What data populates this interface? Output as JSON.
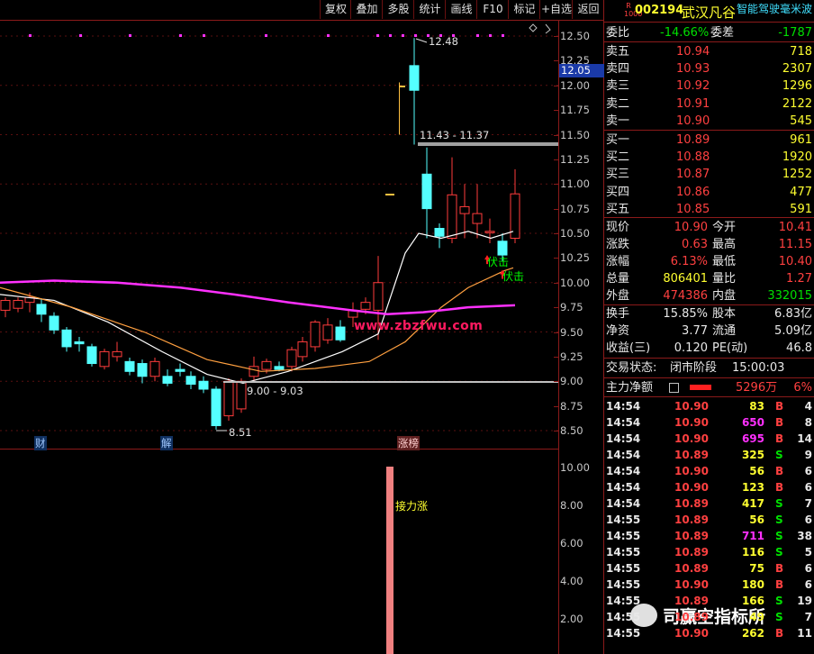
{
  "toolbar": {
    "buttons": [
      "复权",
      "叠加",
      "多股",
      "统计",
      "画线",
      "F10",
      "标记",
      "+自选",
      "返回"
    ]
  },
  "stock": {
    "market_tag": "R\n1000",
    "code": "002194",
    "name": "武汉凡谷",
    "concept": "智能驾驶毫米波"
  },
  "weibi": {
    "label1": "委比",
    "val1": "-14.66%",
    "label2": "委差",
    "val2": "-1787"
  },
  "sell_levels": [
    {
      "label": "卖五",
      "price": "10.94",
      "vol": "718"
    },
    {
      "label": "卖四",
      "price": "10.93",
      "vol": "2307"
    },
    {
      "label": "卖三",
      "price": "10.92",
      "vol": "1296"
    },
    {
      "label": "卖二",
      "price": "10.91",
      "vol": "2122"
    },
    {
      "label": "卖一",
      "price": "10.90",
      "vol": "545"
    }
  ],
  "buy_levels": [
    {
      "label": "买一",
      "price": "10.89",
      "vol": "961"
    },
    {
      "label": "买二",
      "price": "10.88",
      "vol": "1920"
    },
    {
      "label": "买三",
      "price": "10.87",
      "vol": "1252"
    },
    {
      "label": "买四",
      "price": "10.86",
      "vol": "477"
    },
    {
      "label": "买五",
      "price": "10.85",
      "vol": "591"
    }
  ],
  "quote": [
    {
      "l1": "现价",
      "v1": "10.90",
      "c1": "red",
      "l2": "今开",
      "v2": "10.41",
      "c2": "red"
    },
    {
      "l1": "涨跌",
      "v1": "0.63",
      "c1": "red",
      "l2": "最高",
      "v2": "11.15",
      "c2": "red"
    },
    {
      "l1": "涨幅",
      "v1": "6.13%",
      "c1": "red",
      "l2": "最低",
      "v2": "10.40",
      "c2": "red"
    },
    {
      "l1": "总量",
      "v1": "806401",
      "c1": "yel",
      "l2": "量比",
      "v2": "1.27",
      "c2": "red"
    },
    {
      "l1": "外盘",
      "v1": "474386",
      "c1": "red",
      "l2": "内盘",
      "v2": "332015",
      "c2": "grn"
    }
  ],
  "fundamentals": [
    {
      "l1": "换手",
      "v1": "15.85%",
      "l2": "股本",
      "v2": "6.83亿"
    },
    {
      "l1": "净资",
      "v1": "3.77",
      "l2": "流通",
      "v2": "5.09亿"
    },
    {
      "l1": "收益(三)",
      "v1": "0.120",
      "l2": "PE(动)",
      "v2": "46.8"
    }
  ],
  "trade_status": {
    "label": "交易状态:",
    "value": "闭市阶段",
    "time": "15:00:03"
  },
  "main_net": {
    "label": "主力净额",
    "value": "5296万",
    "pct": "6%"
  },
  "ticks": [
    {
      "t": "14:54",
      "p": "10.90",
      "v": "83",
      "vc": "yel",
      "d": "B",
      "n": "4"
    },
    {
      "t": "14:54",
      "p": "10.90",
      "v": "650",
      "vc": "mag",
      "d": "B",
      "n": "8"
    },
    {
      "t": "14:54",
      "p": "10.90",
      "v": "695",
      "vc": "mag",
      "d": "B",
      "n": "14"
    },
    {
      "t": "14:54",
      "p": "10.89",
      "v": "325",
      "vc": "yel",
      "d": "S",
      "n": "9"
    },
    {
      "t": "14:54",
      "p": "10.90",
      "v": "56",
      "vc": "yel",
      "d": "B",
      "n": "6"
    },
    {
      "t": "14:54",
      "p": "10.90",
      "v": "123",
      "vc": "yel",
      "d": "B",
      "n": "6"
    },
    {
      "t": "14:54",
      "p": "10.89",
      "v": "417",
      "vc": "yel",
      "d": "S",
      "n": "7"
    },
    {
      "t": "14:55",
      "p": "10.89",
      "v": "56",
      "vc": "yel",
      "d": "S",
      "n": "6"
    },
    {
      "t": "14:55",
      "p": "10.89",
      "v": "711",
      "vc": "mag",
      "d": "S",
      "n": "38"
    },
    {
      "t": "14:55",
      "p": "10.89",
      "v": "116",
      "vc": "yel",
      "d": "S",
      "n": "5"
    },
    {
      "t": "14:55",
      "p": "10.89",
      "v": "75",
      "vc": "yel",
      "d": "B",
      "n": "6"
    },
    {
      "t": "14:55",
      "p": "10.90",
      "v": "180",
      "vc": "yel",
      "d": "B",
      "n": "6"
    },
    {
      "t": "14:55",
      "p": "10.89",
      "v": "166",
      "vc": "yel",
      "d": "S",
      "n": "19"
    },
    {
      "t": "14:55",
      "p": "10.89",
      "v": "49",
      "vc": "yel",
      "d": "S",
      "n": "7"
    },
    {
      "t": "14:55",
      "p": "10.90",
      "v": "262",
      "vc": "yel",
      "d": "B",
      "n": "11"
    }
  ],
  "chart": {
    "price_ticks": [
      "12.50",
      "12.25",
      "12.00",
      "11.75",
      "11.50",
      "11.25",
      "11.00",
      "10.75",
      "10.50",
      "10.25",
      "10.00",
      "9.75",
      "9.50",
      "9.25",
      "9.00",
      "8.75",
      "8.50"
    ],
    "current_price_tag": "12.05",
    "high_label": "12.48",
    "low_label": "8.51",
    "range_label_high": "11.43 - 11.37",
    "range_label_low": "9.00 - 9.03",
    "watermark": "www.zbzfwu.com",
    "signal_label_1": "伏击",
    "signal_label_2": "伏击",
    "event_tags": [
      "财",
      "解",
      "涨榜"
    ],
    "indicator_ticks": [
      "10.00",
      "8.00",
      "6.00",
      "4.00",
      "2.00"
    ],
    "indicator_label": "接力涨",
    "footer_logo": "司赢空指标所"
  },
  "colors": {
    "up": "#ff3c3c",
    "down": "#54ffff",
    "ma_short": "#ffffff",
    "ma_mid": "#ffa040",
    "ma_long": "#ff30ff",
    "border": "#8b1a1a"
  }
}
